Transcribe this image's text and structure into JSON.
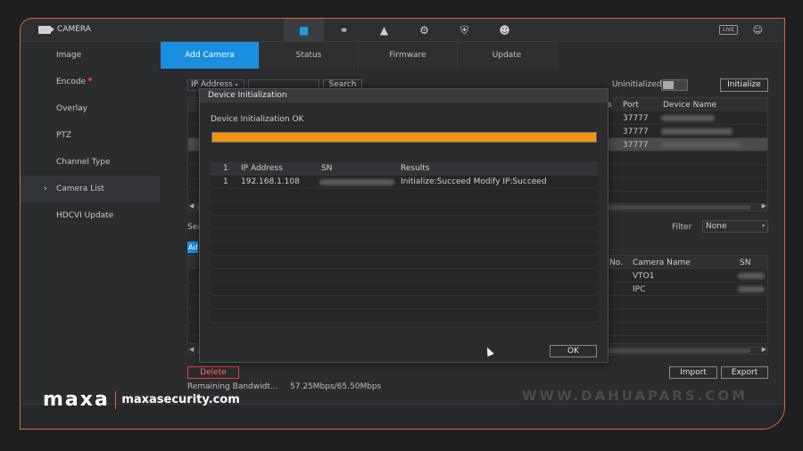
{
  "header": {
    "title": "CAMERA",
    "live_badge": "LIVE"
  },
  "top_icons": [
    "camera-icon",
    "network-icon",
    "storage-icon",
    "settings-icon",
    "security-icon",
    "account-icon"
  ],
  "sidebar": {
    "items": [
      {
        "label": "Image"
      },
      {
        "label": "Encode"
      },
      {
        "label": "Overlay"
      },
      {
        "label": "PTZ"
      },
      {
        "label": "Channel Type"
      },
      {
        "label": "Camera List"
      },
      {
        "label": "HDCVI Update"
      }
    ]
  },
  "tabs": [
    {
      "label": "Add Camera"
    },
    {
      "label": "Status"
    },
    {
      "label": "Firmware"
    },
    {
      "label": "Update"
    }
  ],
  "device_search": {
    "ip_select": "IP Address",
    "search_label": "Search",
    "uninitialized_label": "Uninitialized",
    "initialize_label": "Initialize",
    "columns": {
      "s": "s",
      "port": "Port",
      "device_name": "Device Name"
    },
    "rows": [
      {
        "port": "37777"
      },
      {
        "port": "37777"
      },
      {
        "port": "37777"
      }
    ]
  },
  "added_devices": {
    "sea_fragment": "Sea",
    "add_fragment": "Ad",
    "filter_label": "Filter",
    "filter_value": "None",
    "columns": {
      "no": "No.",
      "camera_name": "Camera Name",
      "sn": "SN"
    },
    "rows": [
      {
        "camera_name": "VTO1"
      },
      {
        "camera_name": "IPC"
      }
    ]
  },
  "footer": {
    "delete_label": "Delete",
    "import_label": "Import",
    "export_label": "Export",
    "bandwidth_label": "Remaining Bandwidt...",
    "bandwidth_value": "57.25Mbps/65.50Mbps"
  },
  "dialog": {
    "title": "Device Initialization",
    "message": "Device Initialization OK",
    "progress": 1.0,
    "progress_color": "#f2930f",
    "columns": {
      "index": "1",
      "ip": "IP Address",
      "sn": "SN",
      "results": "Results"
    },
    "rows": [
      {
        "index": "1",
        "ip": "192.168.1.108",
        "results": "Initialize:Succeed Modify IP:Succeed"
      }
    ],
    "ok_label": "OK"
  },
  "watermark": "WWW.DAHUAPARS.COM",
  "branding": {
    "logo": "maxa",
    "site": "maxasecurity.com",
    "accent": "#e0693a"
  },
  "colors": {
    "accent_blue": "#1a8fe0",
    "frame_orange": "#e0693a",
    "delete_red": "#e04040"
  }
}
